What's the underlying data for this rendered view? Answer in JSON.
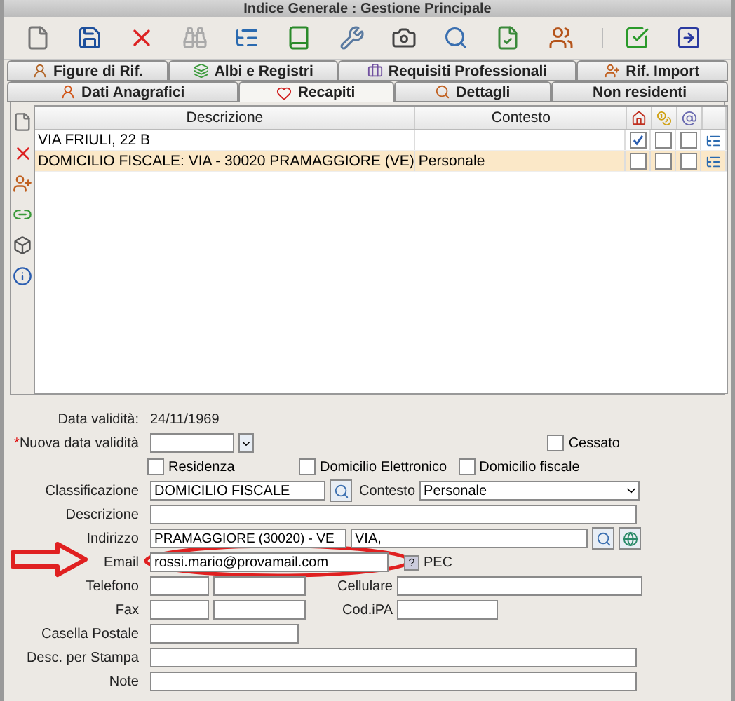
{
  "window": {
    "title": "Indice Generale : Gestione Principale"
  },
  "tabs_top": [
    {
      "label": "Figure di Rif.",
      "selected": false
    },
    {
      "label": "Albi e Registri",
      "selected": false
    },
    {
      "label": "Requisiti Professionali",
      "selected": false
    },
    {
      "label": "Rif. Import",
      "selected": false
    }
  ],
  "tabs_bottom": [
    {
      "label": "Dati Anagrafici",
      "selected": false
    },
    {
      "label": "Recapiti",
      "selected": true
    },
    {
      "label": "Dettagli",
      "selected": false
    },
    {
      "label": "Non residenti",
      "selected": false
    }
  ],
  "table": {
    "columns": [
      "Descrizione",
      "Contesto"
    ],
    "rows": [
      {
        "descrizione": "VIA FRIULI, 22 B",
        "flags": [
          true,
          false,
          false
        ],
        "selected": false
      },
      {
        "descrizione": "DOMICILIO FISCALE: VIA - 30020 PRAMAGGIORE  (VE)",
        "contesto": "Personale",
        "flags": [
          false,
          false,
          false
        ],
        "selected": true
      }
    ]
  },
  "form": {
    "data_validita": {
      "label": "Data validità:",
      "value": "24/11/1969"
    },
    "nuova_data": {
      "label": "Nuova data validità",
      "required_mark": "*"
    },
    "cessato": {
      "label": "Cessato",
      "checked": false
    },
    "options": [
      {
        "label": "Residenza",
        "checked": false
      },
      {
        "label": "Domicilio Elettronico",
        "checked": false
      },
      {
        "label": "Domicilio fiscale",
        "checked": false
      }
    ],
    "classificazione": {
      "label": "Classificazione",
      "value": "DOMICILIO FISCALE"
    },
    "contesto": {
      "label": "Contesto",
      "value": "Personale"
    },
    "descrizione": {
      "label": "Descrizione"
    },
    "indirizzo": {
      "label": "Indirizzo",
      "comune": "PRAMAGGIORE (30020) - VE",
      "via": "VIA,"
    },
    "email": {
      "label": "Email",
      "value": "rossi.mario@provamail.com",
      "pec_label": "PEC",
      "pec_help": "?"
    },
    "telefono": {
      "label": "Telefono"
    },
    "cellulare": {
      "label": "Cellulare"
    },
    "fax": {
      "label": "Fax"
    },
    "cod_ipa": {
      "label": "Cod.iPA"
    },
    "casella_postale": {
      "label": "Casella Postale"
    },
    "desc_stampa": {
      "label": "Desc. per Stampa"
    },
    "note": {
      "label": "Note"
    }
  }
}
